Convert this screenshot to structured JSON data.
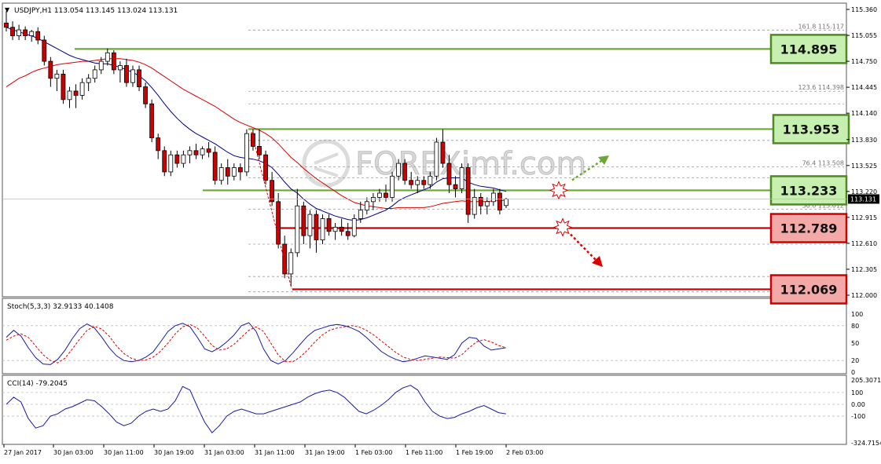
{
  "colors": {
    "bull": "#ffffff",
    "bear": "#cc0000",
    "wick": "#000000",
    "ma_fast": "#00008b",
    "ma_slow": "#dd0000",
    "support_line": "#cc0000",
    "resistance_line": "#6aa832",
    "resistance_box_fill": "#c6efb0",
    "support_box_fill": "#f4a9a9",
    "grid": "#9a9a9a"
  },
  "header": {
    "symbol_title": "USDJPY,H1  113.054 113.145 113.024 113.131"
  },
  "watermark": {
    "text": "FOREXimf.com"
  },
  "fib_labels": [
    {
      "text": "161.8  115.117",
      "price": 115.117
    },
    {
      "text": "123.6  114.398",
      "price": 114.398
    },
    {
      "text": "76.4  113.508",
      "price": 113.508
    },
    {
      "text": "50.0  113.012",
      "price": 113.012
    }
  ],
  "levels": [
    {
      "label": "114.895",
      "value": 114.895,
      "kind": "resistance"
    },
    {
      "label": "113.953",
      "value": 113.953,
      "kind": "resistance"
    },
    {
      "label": "113.233",
      "value": 113.233,
      "kind": "pivot"
    },
    {
      "label": "112.789",
      "value": 112.789,
      "kind": "support"
    },
    {
      "label": "112.069",
      "value": 112.069,
      "kind": "support"
    }
  ],
  "price_axis": {
    "ticks": [
      "115.360",
      "115.055",
      "114.750",
      "114.445",
      "114.140",
      "113.830",
      "113.525",
      "113.220",
      "112.915",
      "112.610",
      "112.305",
      "112.000"
    ],
    "current_price": "113.131"
  },
  "stoch_panel": {
    "title": "Stoch(5,3,3) 32.9133 40.1408",
    "ticks": [
      "100",
      "80",
      "50",
      "20",
      "0"
    ]
  },
  "cci_panel": {
    "title": "CCI(14) -79.2045",
    "ticks": [
      "205.3071",
      "100",
      "0.00",
      "-100",
      "-324.7154"
    ]
  },
  "time_axis": {
    "labels": [
      "27 Jan 2017",
      "30 Jan 03:00",
      "30 Jan 11:00",
      "30 Jan 19:00",
      "31 Jan 03:00",
      "31 Jan 11:00",
      "31 Jan 19:00",
      "1 Feb 03:00",
      "1 Feb 11:00",
      "1 Feb 19:00",
      "2 Feb 03:00"
    ]
  },
  "chart_data": {
    "type": "candlestick",
    "symbol": "USDJPY",
    "timeframe": "H1",
    "ylim": [
      112.0,
      115.36
    ],
    "candles": [
      [
        115.2,
        115.34,
        115.1,
        115.15
      ],
      [
        115.15,
        115.22,
        115.0,
        115.05
      ],
      [
        115.05,
        115.18,
        115.0,
        115.12
      ],
      [
        115.12,
        115.16,
        115.0,
        115.05
      ],
      [
        115.05,
        115.12,
        114.98,
        115.1
      ],
      [
        115.1,
        115.15,
        114.95,
        115.0
      ],
      [
        115.0,
        115.05,
        114.7,
        114.75
      ],
      [
        114.75,
        114.8,
        114.45,
        114.55
      ],
      [
        114.55,
        114.65,
        114.4,
        114.6
      ],
      [
        114.6,
        114.65,
        114.25,
        114.3
      ],
      [
        114.3,
        114.45,
        114.2,
        114.4
      ],
      [
        114.4,
        114.48,
        114.2,
        114.35
      ],
      [
        114.35,
        114.55,
        114.3,
        114.5
      ],
      [
        114.5,
        114.6,
        114.4,
        114.55
      ],
      [
        114.55,
        114.7,
        114.5,
        114.65
      ],
      [
        114.65,
        114.8,
        114.6,
        114.75
      ],
      [
        114.75,
        114.9,
        114.7,
        114.85
      ],
      [
        114.85,
        114.88,
        114.6,
        114.65
      ],
      [
        114.65,
        114.75,
        114.5,
        114.7
      ],
      [
        114.7,
        114.78,
        114.45,
        114.5
      ],
      [
        114.5,
        114.7,
        114.45,
        114.65
      ],
      [
        114.65,
        114.7,
        114.4,
        114.45
      ],
      [
        114.45,
        114.5,
        114.2,
        114.25
      ],
      [
        114.25,
        114.3,
        113.8,
        113.85
      ],
      [
        113.85,
        113.9,
        113.6,
        113.7
      ],
      [
        113.7,
        113.75,
        113.4,
        113.45
      ],
      [
        113.45,
        113.7,
        113.4,
        113.65
      ],
      [
        113.65,
        113.7,
        113.5,
        113.55
      ],
      [
        113.55,
        113.7,
        113.5,
        113.65
      ],
      [
        113.65,
        113.75,
        113.55,
        113.7
      ],
      [
        113.7,
        113.78,
        113.6,
        113.65
      ],
      [
        113.65,
        113.75,
        113.6,
        113.72
      ],
      [
        113.72,
        113.8,
        113.62,
        113.68
      ],
      [
        113.68,
        113.75,
        113.3,
        113.35
      ],
      [
        113.35,
        113.55,
        113.3,
        113.5
      ],
      [
        113.5,
        113.6,
        113.3,
        113.4
      ],
      [
        113.4,
        113.55,
        113.35,
        113.5
      ],
      [
        113.5,
        113.55,
        113.35,
        113.45
      ],
      [
        113.45,
        113.95,
        113.4,
        113.9
      ],
      [
        113.9,
        113.95,
        113.7,
        113.75
      ],
      [
        113.75,
        113.95,
        113.6,
        113.65
      ],
      [
        113.65,
        113.7,
        113.3,
        113.35
      ],
      [
        113.35,
        113.45,
        113.05,
        113.1
      ],
      [
        113.1,
        113.2,
        112.55,
        112.6
      ],
      [
        112.6,
        112.7,
        112.2,
        112.25
      ],
      [
        112.25,
        112.55,
        112.1,
        112.5
      ],
      [
        112.5,
        113.25,
        112.45,
        113.05
      ],
      [
        113.05,
        113.1,
        112.6,
        112.7
      ],
      [
        112.7,
        113.0,
        112.55,
        112.95
      ],
      [
        112.95,
        113.0,
        112.5,
        112.65
      ],
      [
        112.65,
        112.95,
        112.6,
        112.9
      ],
      [
        112.9,
        112.95,
        112.7,
        112.75
      ],
      [
        112.75,
        112.85,
        112.65,
        112.8
      ],
      [
        112.8,
        112.9,
        112.7,
        112.75
      ],
      [
        112.75,
        112.85,
        112.65,
        112.7
      ],
      [
        112.7,
        112.95,
        112.68,
        112.9
      ],
      [
        112.9,
        113.1,
        112.85,
        113.0
      ],
      [
        113.0,
        113.15,
        112.95,
        113.1
      ],
      [
        113.1,
        113.2,
        113.0,
        113.15
      ],
      [
        113.15,
        113.25,
        113.1,
        113.2
      ],
      [
        113.2,
        113.3,
        113.1,
        113.15
      ],
      [
        113.15,
        113.45,
        113.1,
        113.4
      ],
      [
        113.4,
        113.6,
        113.35,
        113.55
      ],
      [
        113.55,
        113.6,
        113.3,
        113.35
      ],
      [
        113.35,
        113.45,
        113.25,
        113.3
      ],
      [
        113.3,
        113.4,
        113.2,
        113.35
      ],
      [
        113.35,
        113.4,
        113.25,
        113.3
      ],
      [
        113.3,
        113.45,
        113.25,
        113.4
      ],
      [
        113.4,
        113.85,
        113.35,
        113.8
      ],
      [
        113.8,
        113.95,
        113.5,
        113.55
      ],
      [
        113.55,
        113.65,
        113.2,
        113.3
      ],
      [
        113.3,
        113.4,
        113.15,
        113.25
      ],
      [
        113.25,
        113.55,
        113.2,
        113.5
      ],
      [
        113.5,
        113.55,
        112.85,
        112.95
      ],
      [
        112.95,
        113.25,
        112.9,
        113.15
      ],
      [
        113.15,
        113.2,
        112.95,
        113.05
      ],
      [
        113.05,
        113.15,
        112.95,
        113.1
      ],
      [
        113.1,
        113.25,
        113.05,
        113.2
      ],
      [
        113.2,
        113.25,
        112.95,
        113.0
      ],
      [
        113.054,
        113.145,
        113.024,
        113.131
      ]
    ],
    "ma_fast": [
      115.15,
      115.12,
      115.1,
      115.07,
      115.05,
      115.02,
      114.98,
      114.94,
      114.9,
      114.86,
      114.82,
      114.79,
      114.77,
      114.75,
      114.73,
      114.72,
      114.72,
      114.7,
      114.68,
      114.65,
      114.62,
      114.58,
      114.52,
      114.44,
      114.35,
      114.25,
      114.16,
      114.08,
      114.01,
      113.95,
      113.9,
      113.86,
      113.82,
      113.78,
      113.73,
      113.68,
      113.64,
      113.62,
      113.61,
      113.6,
      113.58,
      113.55,
      113.5,
      113.42,
      113.33,
      113.25,
      113.2,
      113.13,
      113.07,
      113.02,
      112.99,
      112.96,
      112.93,
      112.91,
      112.89,
      112.88,
      112.89,
      112.91,
      112.94,
      112.97,
      113.0,
      113.05,
      113.11,
      113.15,
      113.18,
      113.21,
      113.24,
      113.27,
      113.33,
      113.37,
      113.38,
      113.38,
      113.38,
      113.33,
      113.3,
      113.28,
      113.27,
      113.26,
      113.24,
      113.22
    ],
    "ma_slow": [
      114.45,
      114.5,
      114.55,
      114.58,
      114.62,
      114.65,
      114.67,
      114.69,
      114.71,
      114.72,
      114.73,
      114.74,
      114.75,
      114.75,
      114.76,
      114.77,
      114.78,
      114.78,
      114.78,
      114.77,
      114.76,
      114.74,
      114.71,
      114.67,
      114.62,
      114.57,
      114.52,
      114.47,
      114.42,
      114.38,
      114.34,
      114.3,
      114.26,
      114.22,
      114.17,
      114.12,
      114.07,
      114.03,
      114.0,
      113.97,
      113.94,
      113.9,
      113.85,
      113.78,
      113.7,
      113.62,
      113.56,
      113.49,
      113.43,
      113.37,
      113.32,
      113.27,
      113.22,
      113.17,
      113.13,
      113.09,
      113.07,
      113.05,
      113.04,
      113.03,
      113.02,
      113.02,
      113.03,
      113.03,
      113.03,
      113.03,
      113.03,
      113.04,
      113.06,
      113.08,
      113.09,
      113.1,
      113.11,
      113.1,
      113.1,
      113.1,
      113.1,
      113.11,
      113.11,
      113.12
    ],
    "stoch_main": [
      60,
      72,
      62,
      42,
      25,
      14,
      13,
      22,
      38,
      58,
      75,
      83,
      76,
      60,
      42,
      28,
      20,
      18,
      20,
      26,
      35,
      52,
      70,
      80,
      84,
      78,
      60,
      40,
      35,
      42,
      52,
      64,
      80,
      85,
      70,
      40,
      20,
      14,
      20,
      33,
      48,
      62,
      72,
      76,
      80,
      82,
      80,
      76,
      70,
      60,
      48,
      36,
      28,
      22,
      18,
      20,
      24,
      28,
      26,
      24,
      22,
      30,
      50,
      60,
      58,
      45,
      38,
      40,
      42
    ],
    "stoch_signal": [
      55,
      62,
      66,
      60,
      45,
      30,
      20,
      16,
      24,
      40,
      57,
      72,
      79,
      74,
      62,
      45,
      32,
      24,
      20,
      21,
      26,
      36,
      50,
      66,
      78,
      82,
      76,
      62,
      46,
      38,
      40,
      48,
      60,
      72,
      78,
      70,
      50,
      30,
      18,
      18,
      26,
      38,
      52,
      64,
      72,
      76,
      78,
      80,
      78,
      72,
      64,
      54,
      44,
      34,
      26,
      22,
      20,
      22,
      24,
      26,
      25,
      24,
      30,
      42,
      52,
      56,
      52,
      46,
      42
    ],
    "cci": [
      0,
      60,
      20,
      -120,
      -200,
      -180,
      -100,
      -80,
      -40,
      -20,
      10,
      40,
      30,
      -20,
      -80,
      -150,
      -180,
      -160,
      -100,
      -60,
      -40,
      -60,
      -40,
      30,
      150,
      120,
      -20,
      -150,
      -240,
      -180,
      -100,
      -60,
      -40,
      -60,
      -80,
      -80,
      -60,
      -40,
      -20,
      0,
      20,
      60,
      90,
      110,
      120,
      100,
      60,
      0,
      -60,
      -80,
      -50,
      -10,
      40,
      100,
      140,
      160,
      120,
      20,
      -60,
      -100,
      -120,
      -110,
      -80,
      -60,
      -30,
      -10,
      -40,
      -70,
      -80
    ]
  }
}
